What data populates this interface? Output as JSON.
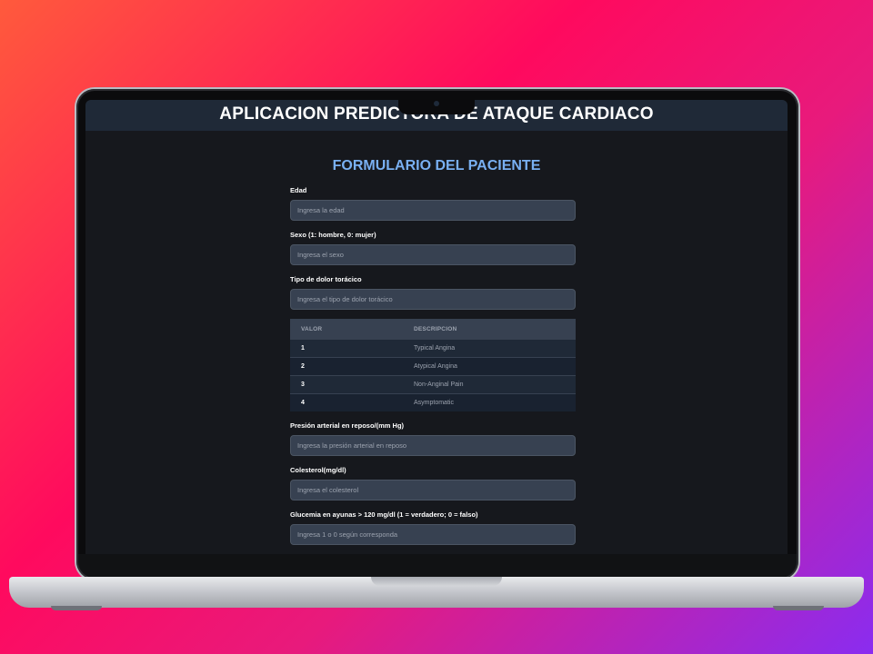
{
  "app": {
    "title": "APLICACION PREDICTORA DE ATAQUE CARDIACO"
  },
  "form": {
    "title": "FORMULARIO DEL PACIENTE",
    "fields": [
      {
        "label": "Edad",
        "placeholder": "Ingresa la edad"
      },
      {
        "label": "Sexo (1: hombre, 0: mujer)",
        "placeholder": "Ingresa el sexo"
      },
      {
        "label": "Tipo de dolor torácico",
        "placeholder": "Ingresa el tipo de dolor torácico"
      },
      {
        "label": "Presión arterial en reposo/(mm Hg)",
        "placeholder": "Ingresa la presión arterial en reposo"
      },
      {
        "label": "Colesterol(mg/dl)",
        "placeholder": "Ingresa el colesterol"
      },
      {
        "label": "Glucemia en ayunas > 120 mg/dl (1 = verdadero; 0 = falso)",
        "placeholder": "Ingresa 1 o 0 según corresponda"
      }
    ],
    "chest_pain_table": {
      "headers": [
        "VALOR",
        "DESCRIPCION"
      ],
      "rows": [
        {
          "value": "1",
          "description": "Typical Angina"
        },
        {
          "value": "2",
          "description": "Atypical Angina"
        },
        {
          "value": "3",
          "description": "Non-Anginal Pain"
        },
        {
          "value": "4",
          "description": "Asymptomatic"
        }
      ]
    }
  },
  "colors": {
    "header_bg": "#1f2937",
    "page_bg": "#16181d",
    "accent_title": "#79b0f2",
    "input_bg": "#374151"
  }
}
